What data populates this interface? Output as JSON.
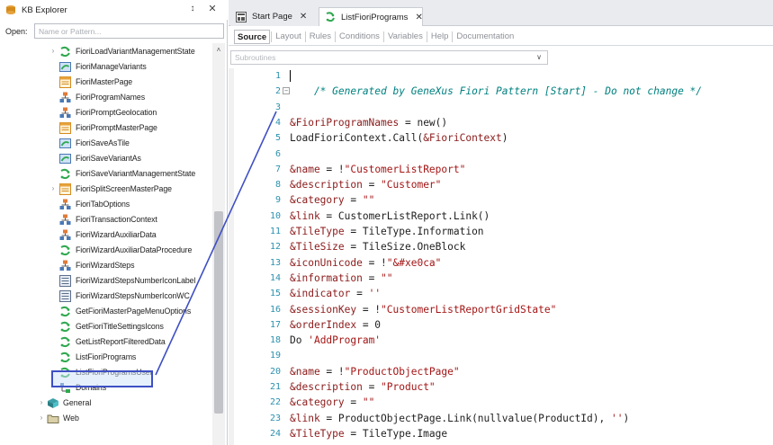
{
  "kb_explorer": {
    "title": "KB Explorer",
    "pin_glyph": "↕",
    "close_glyph": "✕",
    "open_label": "Open:",
    "open_placeholder": "Name or Pattern...",
    "scroll_up_glyph": "˄",
    "items": [
      {
        "label": "FioriLoadVariantManagementState",
        "icon": "procedure-icon"
      },
      {
        "label": "FioriManageVariants",
        "icon": "dataprovider-icon"
      },
      {
        "label": "FioriMasterPage",
        "icon": "masterpage-icon"
      },
      {
        "label": "FioriProgramNames",
        "icon": "sdt-icon"
      },
      {
        "label": "FioriPromptGeolocation",
        "icon": "sdt-icon"
      },
      {
        "label": "FioriPromptMasterPage",
        "icon": "masterpage-icon"
      },
      {
        "label": "FioriSaveAsTile",
        "icon": "dataprovider-icon"
      },
      {
        "label": "FioriSaveVariantAs",
        "icon": "dataprovider-icon"
      },
      {
        "label": "FioriSaveVariantManagementState",
        "icon": "procedure-icon"
      },
      {
        "label": "FioriSplitScreenMasterPage",
        "icon": "masterpage-icon"
      },
      {
        "label": "FioriTabOptions",
        "icon": "sdt-icon"
      },
      {
        "label": "FioriTransactionContext",
        "icon": "sdt-icon"
      },
      {
        "label": "FioriWizardAuxiliarData",
        "icon": "sdt-icon"
      },
      {
        "label": "FioriWizardAuxiliarDataProcedure",
        "icon": "procedure-icon"
      },
      {
        "label": "FioriWizardSteps",
        "icon": "sdt-icon"
      },
      {
        "label": "FioriWizardStepsNumberIconLabel",
        "icon": "webcomponent-icon"
      },
      {
        "label": "FioriWizardStepsNumberIconWC",
        "icon": "webcomponent-icon"
      },
      {
        "label": "GetFioriMasterPageMenuOptions",
        "icon": "procedure-icon"
      },
      {
        "label": "GetFioriTitleSettingsIcons",
        "icon": "procedure-icon"
      },
      {
        "label": "GetListReportFilteredData",
        "icon": "procedure-icon"
      },
      {
        "label": "ListFioriPrograms",
        "icon": "procedure-icon"
      },
      {
        "label": "ListFioriProgramsUser",
        "icon": "procedure-icon"
      },
      {
        "label": "Domains",
        "icon": "domains-icon"
      }
    ],
    "roots": [
      {
        "label": "General",
        "icon": "module-icon"
      },
      {
        "label": "Web",
        "icon": "folder-icon"
      }
    ]
  },
  "editor": {
    "tabs": [
      {
        "label": "Start Page",
        "close": "✕"
      },
      {
        "label": "ListFioriPrograms",
        "close": "✕"
      }
    ],
    "part_tabs": [
      "Source",
      "Layout",
      "Rules",
      "Conditions",
      "Variables",
      "Help",
      "Documentation"
    ],
    "subroutines_placeholder": "Subroutines",
    "subroutines_arrow": "∨",
    "fold_glyph": "−",
    "code_lines": [
      {
        "n": "1",
        "text": ""
      },
      {
        "n": "2",
        "text": "    /* Generated by GeneXus Fiori Pattern [Start] - Do not change */",
        "kind": "comment"
      },
      {
        "n": "3",
        "text": ""
      },
      {
        "n": "4",
        "text": "&FioriProgramNames = new()"
      },
      {
        "n": "5",
        "text": "LoadFioriContext.Call(&FioriContext)"
      },
      {
        "n": "6",
        "text": ""
      },
      {
        "n": "7",
        "text": "&name = !\"CustomerListReport\""
      },
      {
        "n": "8",
        "text": "&description = \"Customer\""
      },
      {
        "n": "9",
        "text": "&category = \"\""
      },
      {
        "n": "10",
        "text": "&link = CustomerListReport.Link()"
      },
      {
        "n": "11",
        "text": "&TileType = TileType.Information"
      },
      {
        "n": "12",
        "text": "&TileSize = TileSize.OneBlock"
      },
      {
        "n": "13",
        "text": "&iconUnicode = !\"&#xe0ca\""
      },
      {
        "n": "14",
        "text": "&information = \"\""
      },
      {
        "n": "15",
        "text": "&indicator = ''"
      },
      {
        "n": "16",
        "text": "&sessionKey = !\"CustomerListReportGridState\""
      },
      {
        "n": "17",
        "text": "&orderIndex = 0"
      },
      {
        "n": "18",
        "text": "Do 'AddProgram'"
      },
      {
        "n": "19",
        "text": ""
      },
      {
        "n": "20",
        "text": "&name = !\"ProductObjectPage\""
      },
      {
        "n": "21",
        "text": "&description = \"Product\""
      },
      {
        "n": "22",
        "text": "&category = \"\""
      },
      {
        "n": "23",
        "text": "&link = ProductObjectPage.Link(nullvalue(ProductId), '')"
      },
      {
        "n": "24",
        "text": "&TileType = TileType.Image"
      }
    ]
  },
  "colors": {
    "accent_blue": "#3e4fc4",
    "line_number": "#2b91af",
    "comment": "#008080",
    "string": "#a31515",
    "variable": "#8b1a1a"
  }
}
